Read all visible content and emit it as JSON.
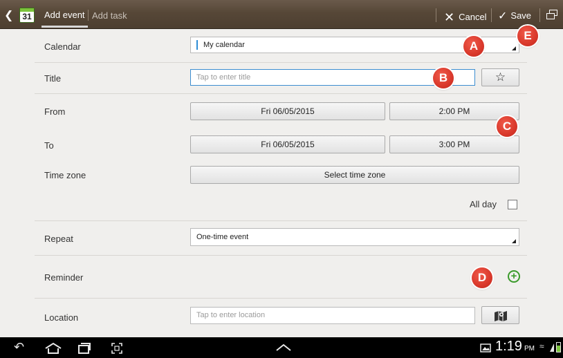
{
  "actionbar": {
    "calendar_icon_day": "31",
    "tabs": [
      {
        "label": "Add event",
        "selected": true
      },
      {
        "label": "Add task",
        "selected": false
      }
    ],
    "cancel_label": "Cancel",
    "save_label": "Save"
  },
  "form": {
    "calendar": {
      "label": "Calendar",
      "value": "My calendar",
      "accent": "#2e8dd6"
    },
    "title": {
      "label": "Title",
      "placeholder": "Tap to enter title",
      "value": ""
    },
    "from": {
      "label": "From",
      "date": "Fri 06/05/2015",
      "time": "2:00 PM"
    },
    "to": {
      "label": "To",
      "date": "Fri 06/05/2015",
      "time": "3:00 PM"
    },
    "timezone": {
      "label": "Time zone",
      "button": "Select time zone"
    },
    "allday": {
      "label": "All day",
      "checked": false
    },
    "repeat": {
      "label": "Repeat",
      "value": "One-time event"
    },
    "reminder": {
      "label": "Reminder"
    },
    "location": {
      "label": "Location",
      "placeholder": "Tap to enter location",
      "value": ""
    }
  },
  "markers": {
    "a": "A",
    "b": "B",
    "c": "C",
    "d": "D",
    "e": "E",
    "color": "#d9382b"
  },
  "statusbar": {
    "time": "1:19",
    "ampm": "PM"
  },
  "icons": {
    "back": "chevron-left-icon",
    "cancel": "close-icon",
    "save": "checkmark-icon",
    "window": "multi-window-icon",
    "favorite": "star-icon",
    "add_reminder": "plus-circle-icon",
    "map": "map-icon",
    "nav": [
      "back-icon",
      "home-icon",
      "recent-apps-icon",
      "screenshot-icon",
      "up-arrow-icon",
      "gallery-icon",
      "wifi-icon",
      "battery-icon"
    ]
  }
}
